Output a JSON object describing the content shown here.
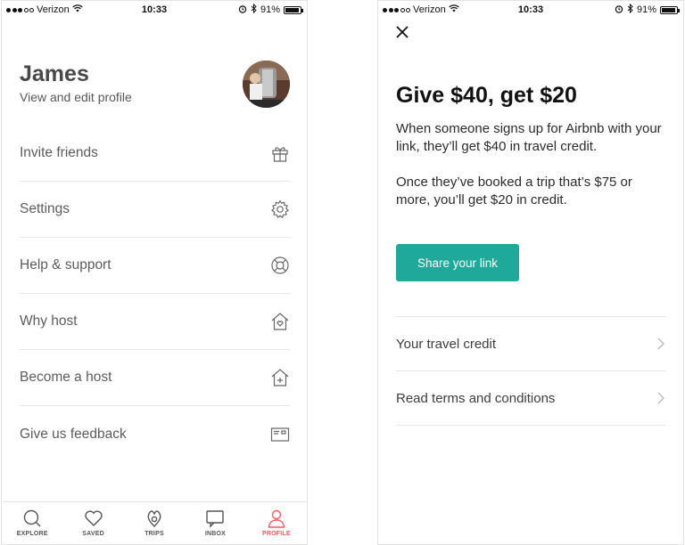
{
  "status_bar": {
    "carrier": "Verizon",
    "time": "10:33",
    "battery": "91%",
    "battery_level": 0.91
  },
  "profile_screen": {
    "name": "James",
    "subtitle": "View and edit profile",
    "menu": [
      {
        "label": "Invite friends",
        "icon": "gift-icon"
      },
      {
        "label": "Settings",
        "icon": "gear-icon"
      },
      {
        "label": "Help & support",
        "icon": "lifebuoy-icon"
      },
      {
        "label": "Why host",
        "icon": "house-heart-icon"
      },
      {
        "label": "Become a host",
        "icon": "house-plus-icon"
      },
      {
        "label": "Give us feedback",
        "icon": "feedback-card-icon"
      }
    ],
    "tabs": [
      {
        "label": "EXPLORE",
        "icon": "search-icon",
        "active": false
      },
      {
        "label": "SAVED",
        "icon": "heart-icon",
        "active": false
      },
      {
        "label": "TRIPS",
        "icon": "airbnb-logo-icon",
        "active": false
      },
      {
        "label": "INBOX",
        "icon": "message-icon",
        "active": false
      },
      {
        "label": "PROFILE",
        "icon": "person-icon",
        "active": true
      }
    ],
    "active_color": "#FF5A5F"
  },
  "referral_screen": {
    "headline": "Give $40, get $20",
    "paragraph1": "When someone signs up for Airbnb with your link, they’ll get $40 in travel credit.",
    "paragraph2": "Once they’ve booked a trip that’s $75 or more, you’ll get $20 in credit.",
    "share_button": "Share your link",
    "share_button_color": "#1fa99a",
    "links": [
      {
        "label": "Your travel credit"
      },
      {
        "label": "Read terms and conditions"
      }
    ]
  }
}
